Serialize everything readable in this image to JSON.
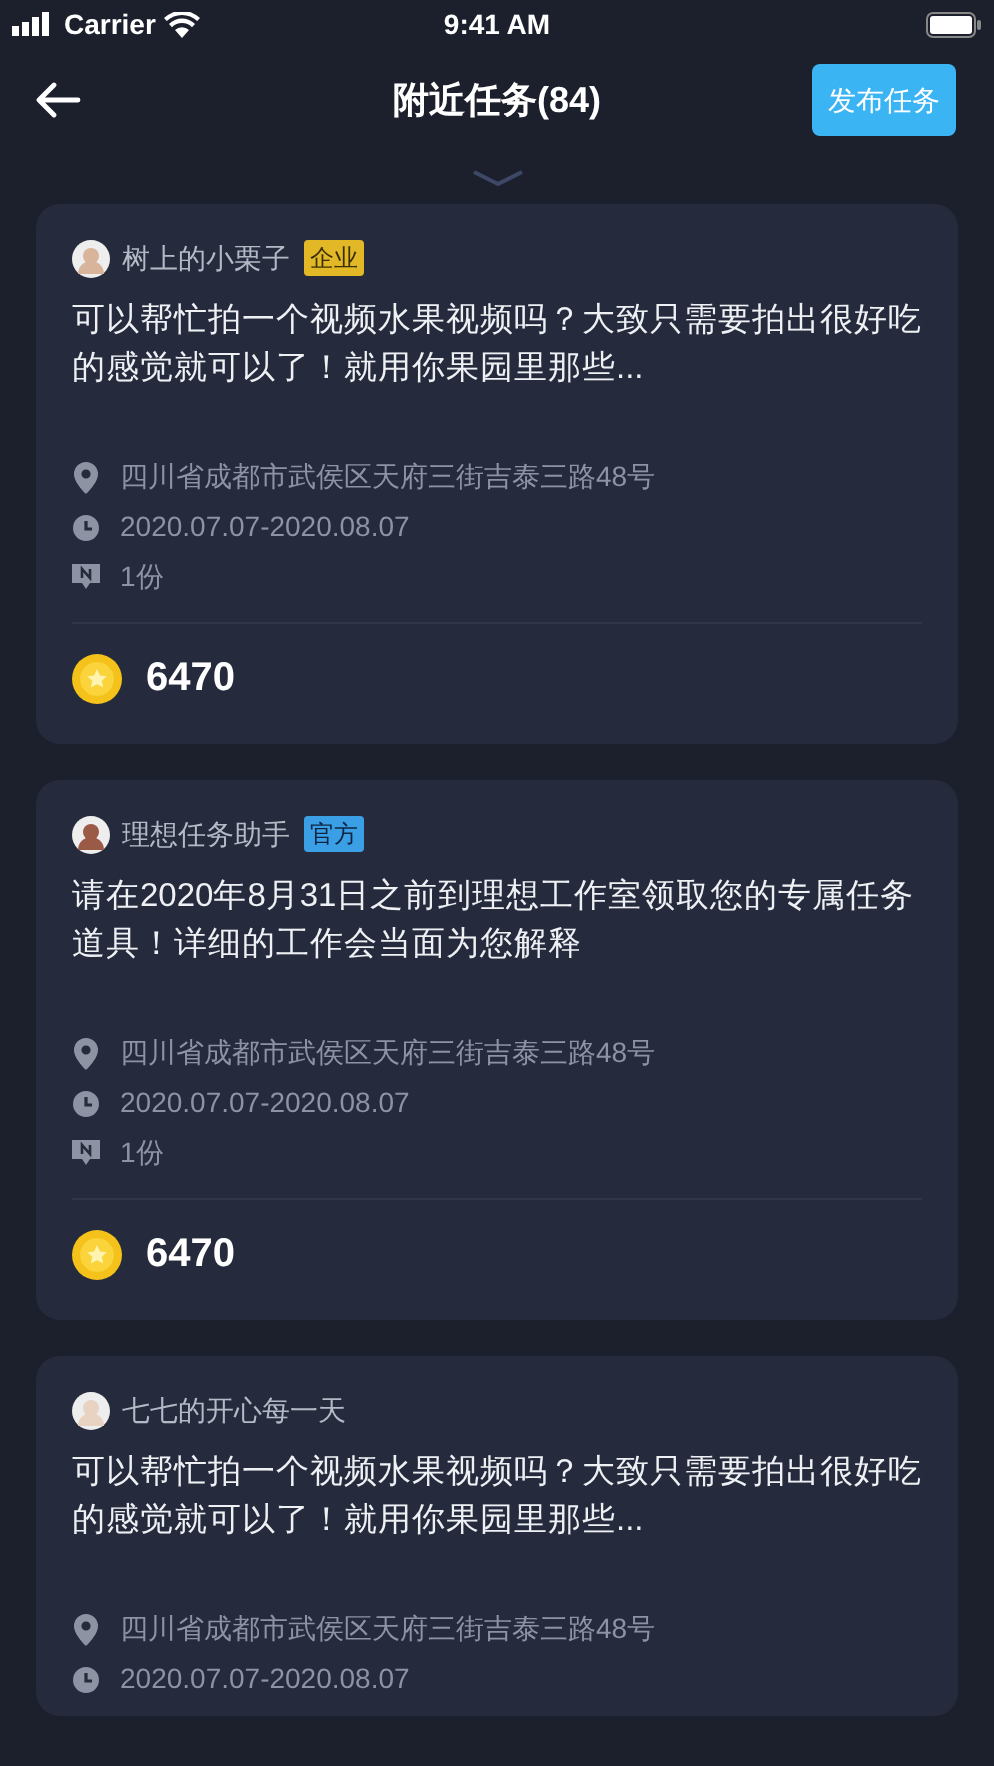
{
  "status_bar": {
    "carrier": "Carrier",
    "time": "9:41 AM"
  },
  "header": {
    "title": "附近任务(84)",
    "action": "发布任务"
  },
  "tasks": [
    {
      "user": "树上的小栗子",
      "tag": {
        "text": "企业",
        "kind": "enterprise"
      },
      "description": "可以帮忙拍一个视频水果视频吗？大致只需要拍出很好吃的感觉就可以了！就用你果园里那些...",
      "address": "四川省成都市武侯区天府三街吉泰三路48号",
      "dates": "2020.07.07-2020.08.07",
      "quantity": "1份",
      "reward": "6470"
    },
    {
      "user": "理想任务助手",
      "tag": {
        "text": "官方",
        "kind": "official"
      },
      "description": "请在2020年8月31日之前到理想工作室领取您的专属任务道具！详细的工作会当面为您解释",
      "address": "四川省成都市武侯区天府三街吉泰三路48号",
      "dates": "2020.07.07-2020.08.07",
      "quantity": "1份",
      "reward": "6470"
    },
    {
      "user": "七七的开心每一天",
      "description": "可以帮忙拍一个视频水果视频吗？大致只需要拍出很好吃的感觉就可以了！就用你果园里那些...",
      "address": "四川省成都市武侯区天府三街吉泰三路48号",
      "dates": "2020.07.07-2020.08.07"
    }
  ]
}
